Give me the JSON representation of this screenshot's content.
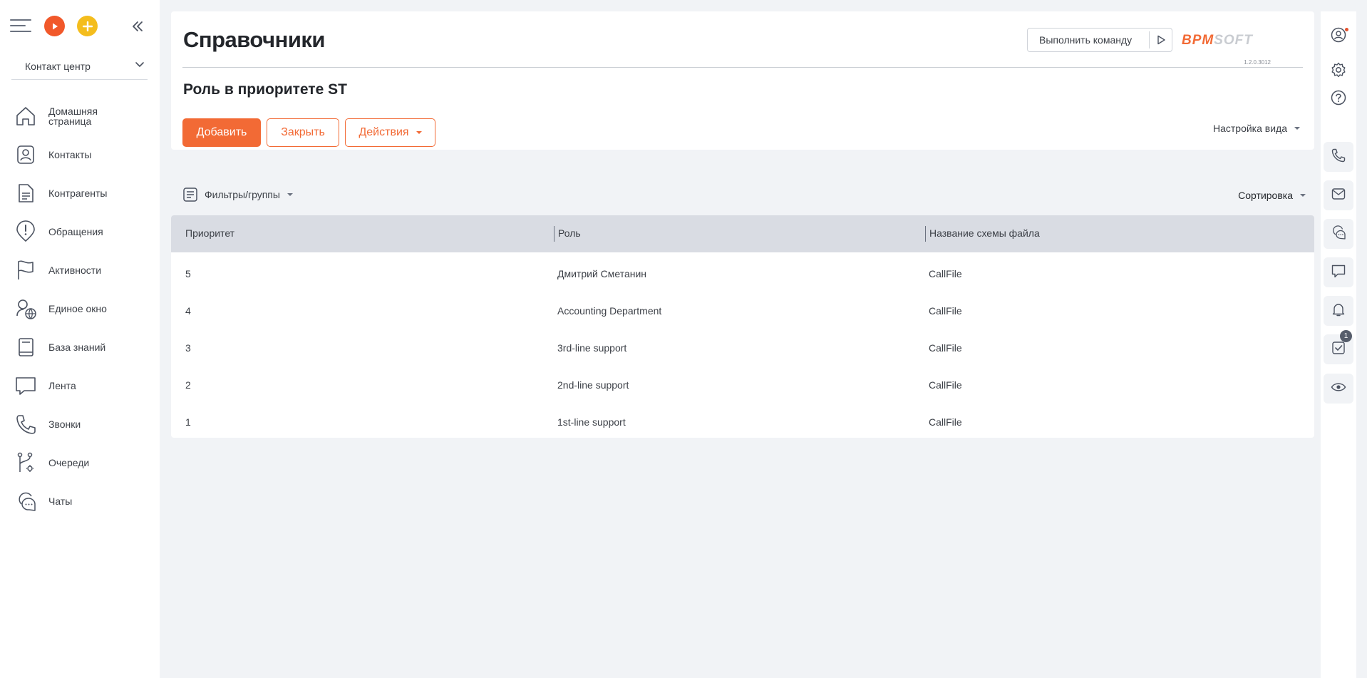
{
  "workspace": {
    "label": "Контакт центр"
  },
  "nav": {
    "items": [
      {
        "label": "Домашняя страница"
      },
      {
        "label": "Контакты"
      },
      {
        "label": "Контрагенты"
      },
      {
        "label": "Обращения"
      },
      {
        "label": "Активности"
      },
      {
        "label": "Единое окно"
      },
      {
        "label": "База знаний"
      },
      {
        "label": "Лента"
      },
      {
        "label": "Звонки"
      },
      {
        "label": "Очереди"
      },
      {
        "label": "Чаты"
      }
    ]
  },
  "header": {
    "title": "Справочники",
    "command_placeholder": "Выполнить команду",
    "logo_part1": "BPM",
    "logo_part2": "SOFT",
    "version": "1.2.0.3012",
    "subtitle": "Роль в приоритете ST"
  },
  "toolbar": {
    "add_label": "Добавить",
    "close_label": "Закрыть",
    "actions_label": "Действия",
    "view_settings_label": "Настройка вида"
  },
  "filters": {
    "filters_label": "Фильтры/группы",
    "sorting_label": "Сортировка"
  },
  "grid": {
    "columns": [
      "Приоритет",
      "Роль",
      "Название схемы файла"
    ],
    "rows": [
      [
        "5",
        "Дмитрий Сметанин",
        "CallFile"
      ],
      [
        "4",
        "Accounting Department",
        "CallFile"
      ],
      [
        "3",
        "3rd-line support",
        "CallFile"
      ],
      [
        "2",
        "2nd-line support",
        "CallFile"
      ],
      [
        "1",
        "1st-line support",
        "CallFile"
      ]
    ]
  },
  "right_rail": {
    "tasks_badge": "1",
    "icons": [
      "user-icon",
      "gear-icon",
      "help-icon",
      "phone-icon",
      "mail-icon",
      "chat-bubbles-icon",
      "message-icon",
      "bell-icon",
      "tasks-icon",
      "eye-icon"
    ]
  },
  "colors": {
    "accent": "#f26a35",
    "play": "#f1582a",
    "plus": "#f4bd1d",
    "grid_header": "#d9dce3",
    "background": "#f1f3f6"
  }
}
